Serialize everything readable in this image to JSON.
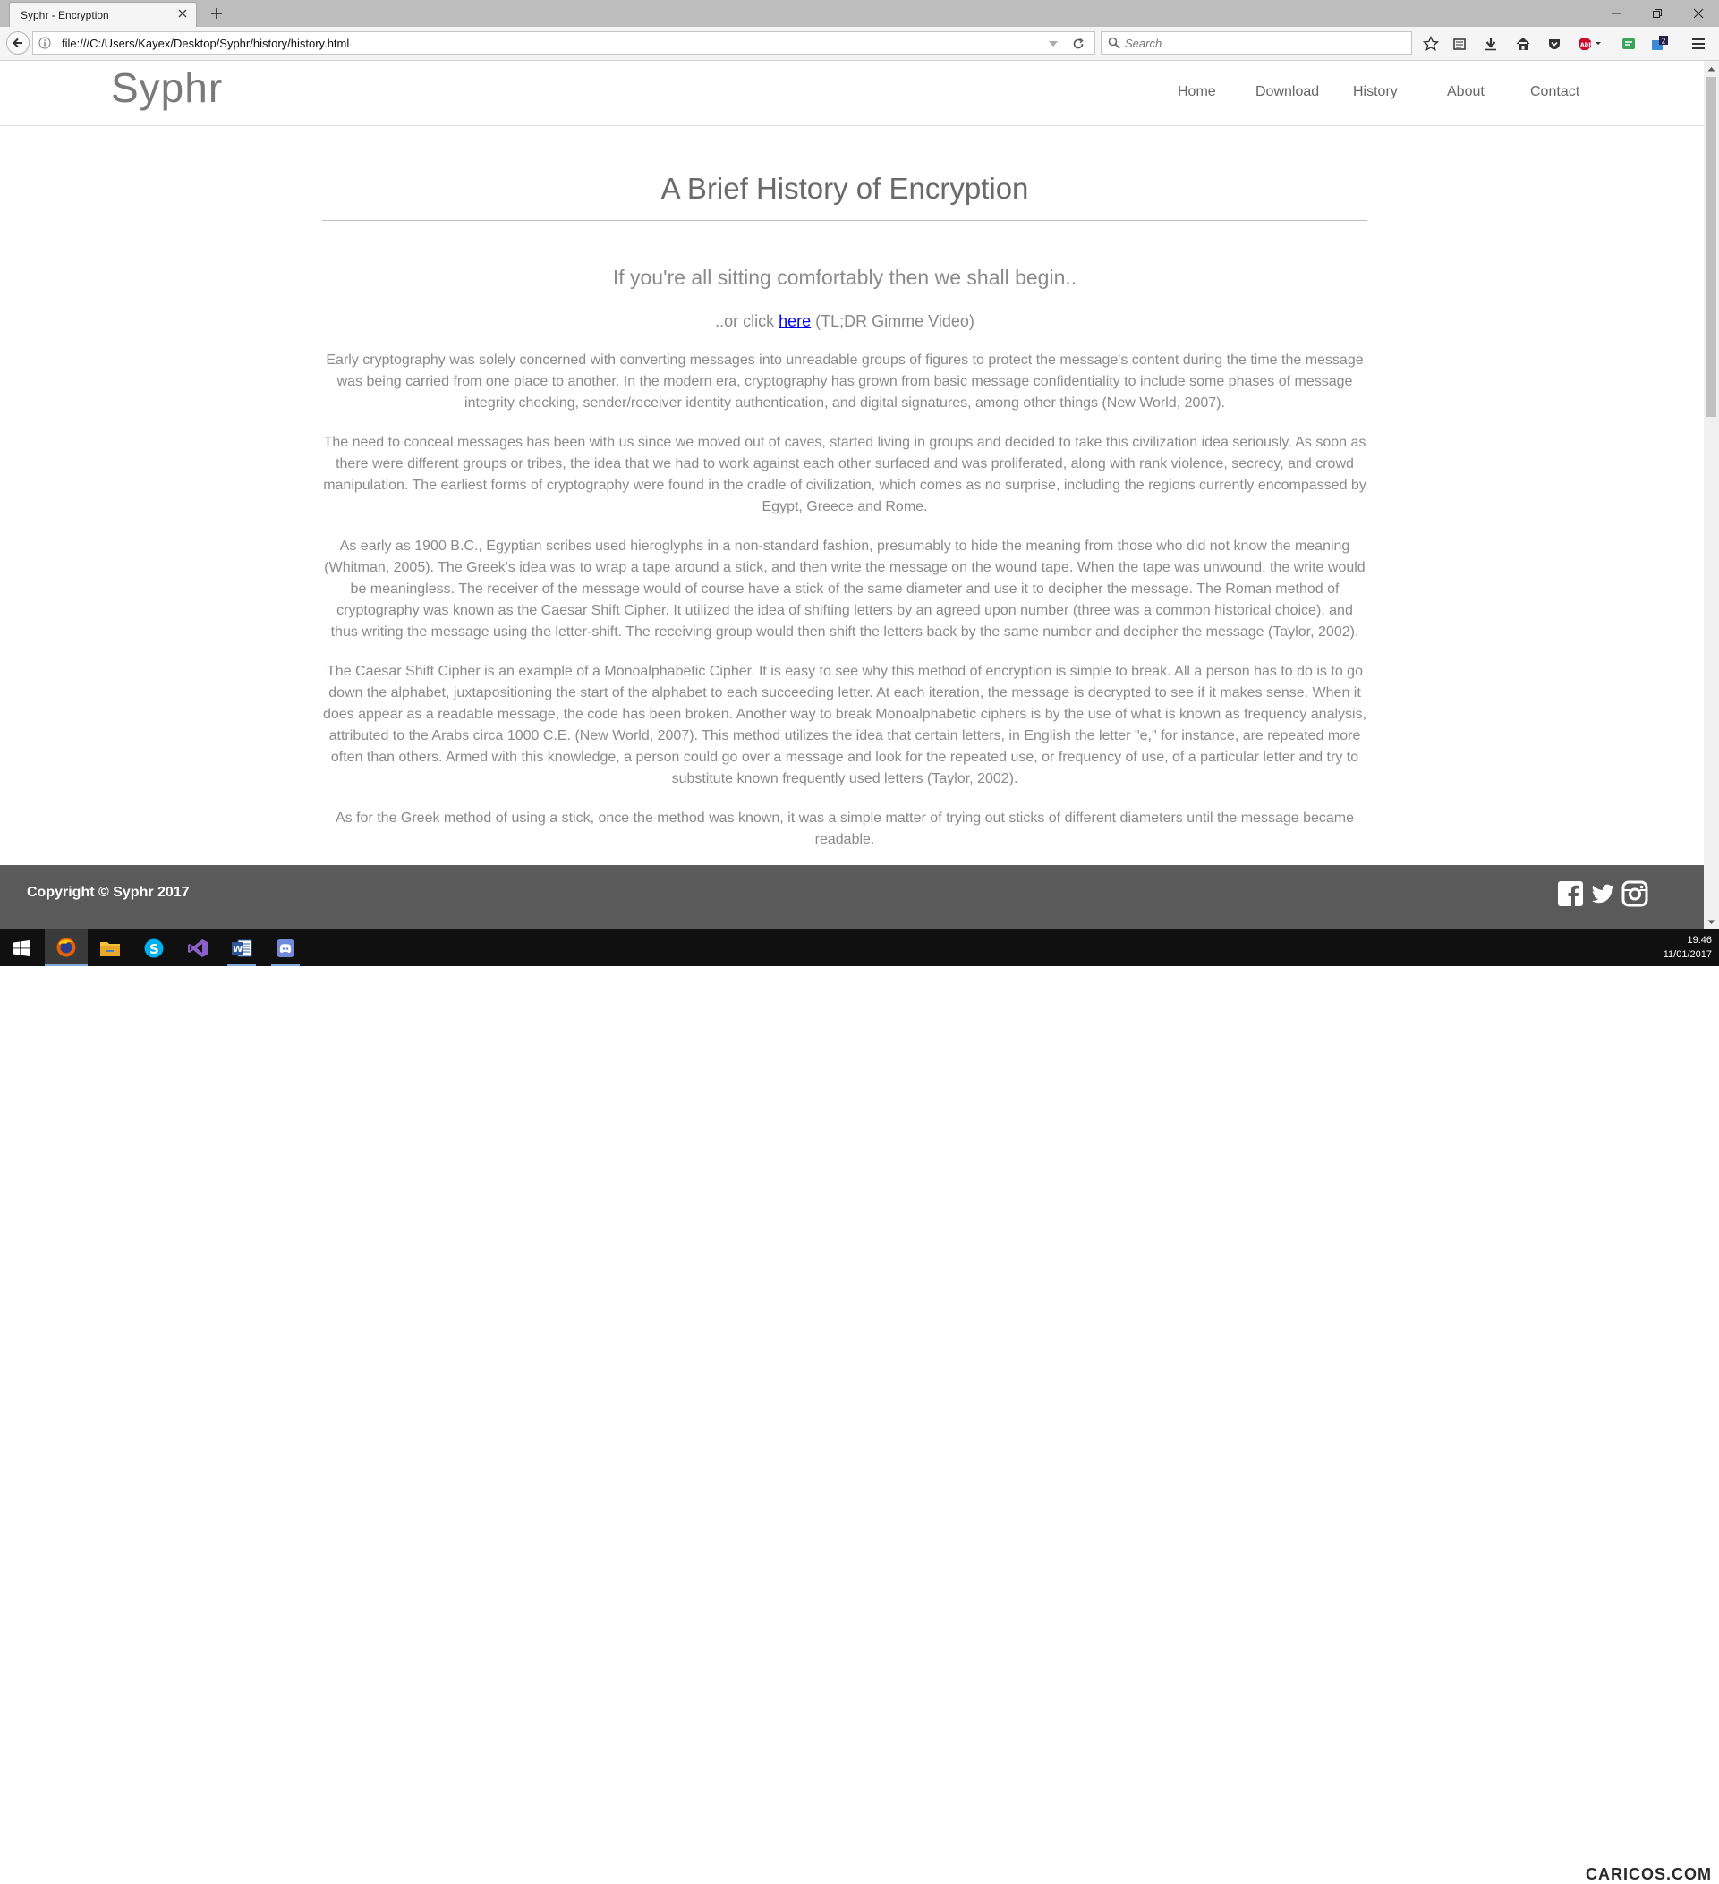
{
  "browser": {
    "tab_title": "Syphr - Encryption",
    "url": "file:///C:/Users/Kayex/Desktop/Syphr/history/history.html",
    "search_placeholder": "Search",
    "badge_count": "2"
  },
  "site": {
    "logo": "Syphr",
    "nav": [
      "Home",
      "Download",
      "History",
      "About",
      "Contact"
    ]
  },
  "article": {
    "title": "A Brief History of Encryption",
    "intro": "If you're all sitting comfortably then we shall begin..",
    "tldr_prefix": "..or click ",
    "tldr_link": "here",
    "tldr_suffix": " (TL;DR Gimme Video)",
    "paragraphs": [
      "Early cryptography was solely concerned with converting messages into unreadable groups of figures to protect the message's content during the time the message was being carried from one place to another. In the modern era, cryptography has grown from basic message confidentiality to include some phases of message integrity checking, sender/receiver identity authentication, and digital signatures, among other things (New World, 2007).",
      "The need to conceal messages has been with us since we moved out of caves, started living in groups and decided to take this civilization idea seriously. As soon as there were different groups or tribes, the idea that we had to work against each other surfaced and was proliferated, along with rank violence, secrecy, and crowd manipulation. The earliest forms of cryptography were found in the cradle of civilization, which comes as no surprise, including the regions currently encompassed by Egypt, Greece and Rome.",
      "As early as 1900 B.C., Egyptian scribes used hieroglyphs in a non-standard fashion, presumably to hide the meaning from those who did not know the meaning (Whitman, 2005). The Greek's idea was to wrap a tape around a stick, and then write the message on the wound tape. When the tape was unwound, the write would be meaningless. The receiver of the message would of course have a stick of the same diameter and use it to decipher the message. The Roman method of cryptography was known as the Caesar Shift Cipher. It utilized the idea of shifting letters by an agreed upon number (three was a common historical choice), and thus writing the message using the letter-shift. The receiving group would then shift the letters back by the same number and decipher the message (Taylor, 2002).",
      "The Caesar Shift Cipher is an example of a Monoalphabetic Cipher. It is easy to see why this method of encryption is simple to break. All a person has to do is to go down the alphabet, juxtapositioning the start of the alphabet to each succeeding letter. At each iteration, the message is decrypted to see if it makes sense. When it does appear as a readable message, the code has been broken. Another way to break Monoalphabetic ciphers is by the use of what is known as frequency analysis, attributed to the Arabs circa 1000 C.E. (New World, 2007). This method utilizes the idea that certain letters, in English the letter \"e,\" for instance, are repeated more often than others. Armed with this knowledge, a person could go over a message and look for the repeated use, or frequency of use, of a particular letter and try to substitute known frequently used letters (Taylor, 2002).",
      "As for the Greek method of using a stick, once the method was known, it was a simple matter of trying out sticks of different diameters until the message became readable."
    ]
  },
  "footer": {
    "copyright": "Copyright © Syphr 2017",
    "social": [
      "facebook-icon",
      "twitter-icon",
      "instagram-icon"
    ]
  },
  "taskbar": {
    "time": "19:46",
    "date": "11/01/2017",
    "watermark": "CARICOS.COM"
  },
  "colors": {
    "footer_bg": "#5a5a5a",
    "link": "#0000ee",
    "text": "#8a8a8a"
  }
}
